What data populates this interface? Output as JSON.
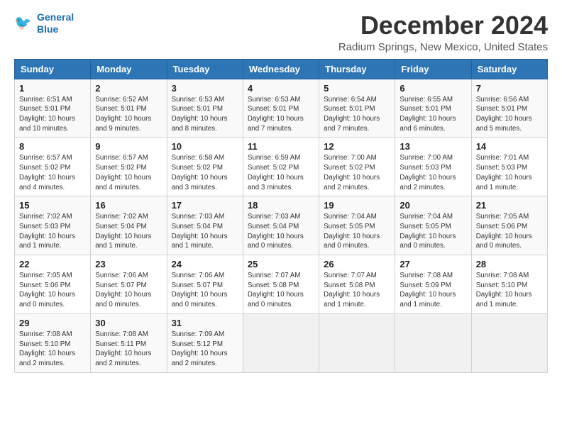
{
  "header": {
    "logo_line1": "General",
    "logo_line2": "Blue",
    "title": "December 2024",
    "subtitle": "Radium Springs, New Mexico, United States"
  },
  "calendar": {
    "days_of_week": [
      "Sunday",
      "Monday",
      "Tuesday",
      "Wednesday",
      "Thursday",
      "Friday",
      "Saturday"
    ],
    "weeks": [
      [
        {
          "day": "1",
          "info": "Sunrise: 6:51 AM\nSunset: 5:01 PM\nDaylight: 10 hours\nand 10 minutes."
        },
        {
          "day": "2",
          "info": "Sunrise: 6:52 AM\nSunset: 5:01 PM\nDaylight: 10 hours\nand 9 minutes."
        },
        {
          "day": "3",
          "info": "Sunrise: 6:53 AM\nSunset: 5:01 PM\nDaylight: 10 hours\nand 8 minutes."
        },
        {
          "day": "4",
          "info": "Sunrise: 6:53 AM\nSunset: 5:01 PM\nDaylight: 10 hours\nand 7 minutes."
        },
        {
          "day": "5",
          "info": "Sunrise: 6:54 AM\nSunset: 5:01 PM\nDaylight: 10 hours\nand 7 minutes."
        },
        {
          "day": "6",
          "info": "Sunrise: 6:55 AM\nSunset: 5:01 PM\nDaylight: 10 hours\nand 6 minutes."
        },
        {
          "day": "7",
          "info": "Sunrise: 6:56 AM\nSunset: 5:01 PM\nDaylight: 10 hours\nand 5 minutes."
        }
      ],
      [
        {
          "day": "8",
          "info": "Sunrise: 6:57 AM\nSunset: 5:02 PM\nDaylight: 10 hours\nand 4 minutes."
        },
        {
          "day": "9",
          "info": "Sunrise: 6:57 AM\nSunset: 5:02 PM\nDaylight: 10 hours\nand 4 minutes."
        },
        {
          "day": "10",
          "info": "Sunrise: 6:58 AM\nSunset: 5:02 PM\nDaylight: 10 hours\nand 3 minutes."
        },
        {
          "day": "11",
          "info": "Sunrise: 6:59 AM\nSunset: 5:02 PM\nDaylight: 10 hours\nand 3 minutes."
        },
        {
          "day": "12",
          "info": "Sunrise: 7:00 AM\nSunset: 5:02 PM\nDaylight: 10 hours\nand 2 minutes."
        },
        {
          "day": "13",
          "info": "Sunrise: 7:00 AM\nSunset: 5:03 PM\nDaylight: 10 hours\nand 2 minutes."
        },
        {
          "day": "14",
          "info": "Sunrise: 7:01 AM\nSunset: 5:03 PM\nDaylight: 10 hours\nand 1 minute."
        }
      ],
      [
        {
          "day": "15",
          "info": "Sunrise: 7:02 AM\nSunset: 5:03 PM\nDaylight: 10 hours\nand 1 minute."
        },
        {
          "day": "16",
          "info": "Sunrise: 7:02 AM\nSunset: 5:04 PM\nDaylight: 10 hours\nand 1 minute."
        },
        {
          "day": "17",
          "info": "Sunrise: 7:03 AM\nSunset: 5:04 PM\nDaylight: 10 hours\nand 1 minute."
        },
        {
          "day": "18",
          "info": "Sunrise: 7:03 AM\nSunset: 5:04 PM\nDaylight: 10 hours\nand 0 minutes."
        },
        {
          "day": "19",
          "info": "Sunrise: 7:04 AM\nSunset: 5:05 PM\nDaylight: 10 hours\nand 0 minutes."
        },
        {
          "day": "20",
          "info": "Sunrise: 7:04 AM\nSunset: 5:05 PM\nDaylight: 10 hours\nand 0 minutes."
        },
        {
          "day": "21",
          "info": "Sunrise: 7:05 AM\nSunset: 5:06 PM\nDaylight: 10 hours\nand 0 minutes."
        }
      ],
      [
        {
          "day": "22",
          "info": "Sunrise: 7:05 AM\nSunset: 5:06 PM\nDaylight: 10 hours\nand 0 minutes."
        },
        {
          "day": "23",
          "info": "Sunrise: 7:06 AM\nSunset: 5:07 PM\nDaylight: 10 hours\nand 0 minutes."
        },
        {
          "day": "24",
          "info": "Sunrise: 7:06 AM\nSunset: 5:07 PM\nDaylight: 10 hours\nand 0 minutes."
        },
        {
          "day": "25",
          "info": "Sunrise: 7:07 AM\nSunset: 5:08 PM\nDaylight: 10 hours\nand 0 minutes."
        },
        {
          "day": "26",
          "info": "Sunrise: 7:07 AM\nSunset: 5:08 PM\nDaylight: 10 hours\nand 1 minute."
        },
        {
          "day": "27",
          "info": "Sunrise: 7:08 AM\nSunset: 5:09 PM\nDaylight: 10 hours\nand 1 minute."
        },
        {
          "day": "28",
          "info": "Sunrise: 7:08 AM\nSunset: 5:10 PM\nDaylight: 10 hours\nand 1 minute."
        }
      ],
      [
        {
          "day": "29",
          "info": "Sunrise: 7:08 AM\nSunset: 5:10 PM\nDaylight: 10 hours\nand 2 minutes."
        },
        {
          "day": "30",
          "info": "Sunrise: 7:08 AM\nSunset: 5:11 PM\nDaylight: 10 hours\nand 2 minutes."
        },
        {
          "day": "31",
          "info": "Sunrise: 7:09 AM\nSunset: 5:12 PM\nDaylight: 10 hours\nand 2 minutes."
        },
        {
          "day": "",
          "info": ""
        },
        {
          "day": "",
          "info": ""
        },
        {
          "day": "",
          "info": ""
        },
        {
          "day": "",
          "info": ""
        }
      ]
    ]
  }
}
